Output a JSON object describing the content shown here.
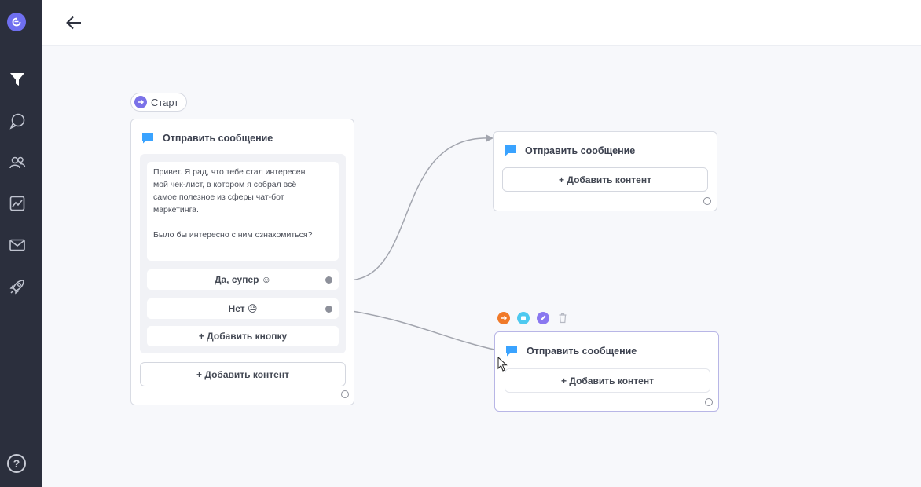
{
  "start": {
    "label": "Старт"
  },
  "node1": {
    "title": "Отправить сообщение",
    "message": "Привет. Я рад, что тебе стал интересен\nмой чек-лист, в котором я собрал всё\nсамое полезное из сферы чат-бот\nмаркетинга.\n\nБыло бы интересно с ним ознакомиться?",
    "buttons": [
      {
        "label": "Да, супер ☺"
      },
      {
        "label": "Нет 😐"
      }
    ],
    "add_button": "+ Добавить кнопку",
    "add_content": "+ Добавить контент"
  },
  "node2": {
    "title": "Отправить сообщение",
    "add_content": "+ Добавить контент"
  },
  "node3": {
    "title": "Отправить сообщение",
    "add_content": "+ Добавить контент"
  },
  "colors": {
    "accent": "#6f6ff0",
    "sidebar": "#2b2f3d",
    "message_icon": "#3aa3ff"
  },
  "icons": [
    "logo-icon",
    "filter-icon",
    "chat-icon",
    "users-icon",
    "analytics-icon",
    "mail-icon",
    "rocket-icon",
    "help-icon",
    "back-arrow-icon"
  ]
}
